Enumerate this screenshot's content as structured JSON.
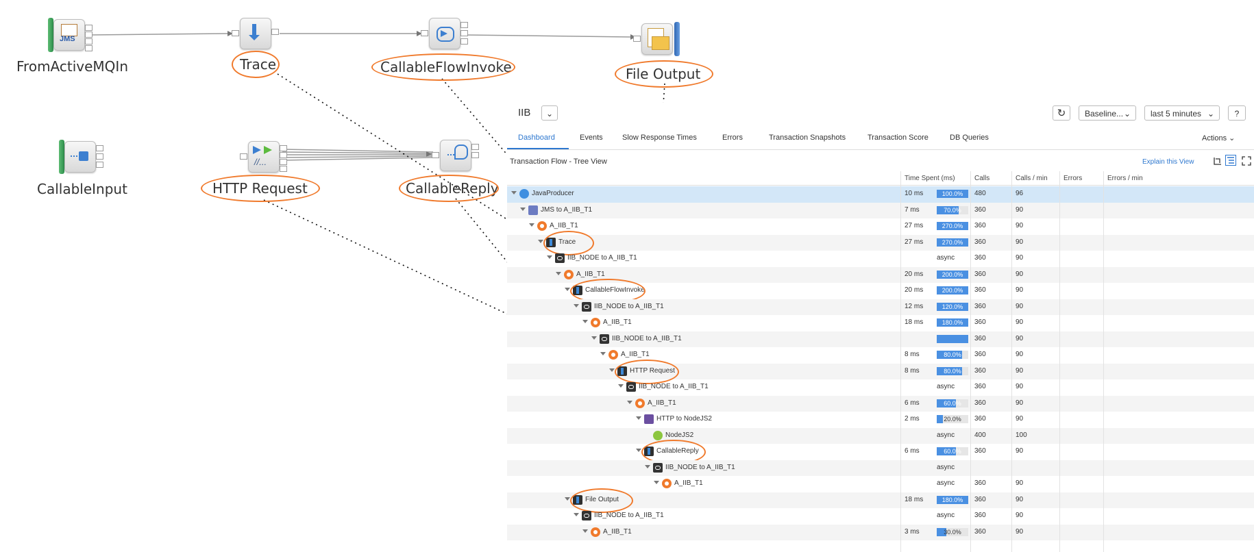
{
  "diagram": {
    "nodes": {
      "from_activemq": "FromActiveMQIn",
      "trace": "Trace",
      "callable_flow_invoke": "CallableFlowInvoke",
      "file_output": "File Output",
      "callable_input": "CallableInput",
      "http_request": "HTTP Request",
      "callable_reply": "CallableReply"
    },
    "icons": {
      "jms_text": "JMS",
      "http_text": "//..."
    },
    "highlight_color": "#f07a2c"
  },
  "dashboard": {
    "app_title": "IIB",
    "refresh_icon": "refresh-icon",
    "baseline_label": "Baseline...",
    "time_range_label": "last 5 minutes",
    "help_label": "?",
    "tabs": [
      "Dashboard",
      "Events",
      "Slow Response Times",
      "Errors",
      "Transaction Snapshots",
      "Transaction Score",
      "DB Queries"
    ],
    "actions_label": "Actions",
    "section_title": "Transaction Flow - Tree View",
    "explain_link": "Explain this View",
    "columns": {
      "time_spent": "Time Spent (ms)",
      "calls": "Calls",
      "calls_per_min": "Calls / min",
      "errors": "Errors",
      "errors_per_min": "Errors / min"
    },
    "accent_color": "#2d77cf",
    "rows": [
      {
        "name": "JavaProducer",
        "icon": "java",
        "level": 0,
        "time": "10 ms",
        "pct": "100.0%",
        "pct_value": 100,
        "calls": "480",
        "cpm": "96"
      },
      {
        "name": "JMS to A_IIB_T1",
        "icon": "jms",
        "level": 1,
        "time": "7 ms",
        "pct": "70.0%",
        "pct_value": 70,
        "calls": "360",
        "cpm": "90"
      },
      {
        "name": "A_IIB_T1",
        "icon": "gear",
        "level": 2,
        "time": "27 ms",
        "pct": "270.0%",
        "pct_value": 270,
        "calls": "360",
        "cpm": "90"
      },
      {
        "name": "Trace",
        "icon": "iib",
        "level": 3,
        "time": "27 ms",
        "pct": "270.0%",
        "pct_value": 270,
        "calls": "360",
        "cpm": "90"
      },
      {
        "name": "IIB_NODE to A_IIB_T1",
        "icon": "conn",
        "level": 4,
        "time": "",
        "async": "async",
        "calls": "360",
        "cpm": "90"
      },
      {
        "name": "A_IIB_T1",
        "icon": "gear",
        "level": 5,
        "time": "20 ms",
        "pct": "200.0%",
        "pct_value": 200,
        "calls": "360",
        "cpm": "90"
      },
      {
        "name": "CallableFlowInvoke",
        "icon": "iib",
        "level": 6,
        "time": "20 ms",
        "pct": "200.0%",
        "pct_value": 200,
        "calls": "360",
        "cpm": "90"
      },
      {
        "name": "IIB_NODE to A_IIB_T1",
        "icon": "conn",
        "level": 7,
        "time": "12 ms",
        "pct": "120.0%",
        "pct_value": 120,
        "calls": "360",
        "cpm": "90"
      },
      {
        "name": "A_IIB_T1",
        "icon": "gear",
        "level": 8,
        "time": "18 ms",
        "pct": "180.0%",
        "pct_value": 180,
        "calls": "360",
        "cpm": "90"
      },
      {
        "name": "IIB_NODE to A_IIB_T1",
        "icon": "conn",
        "level": 9,
        "time": "",
        "pct_value": 100,
        "calls": "360",
        "cpm": "90"
      },
      {
        "name": "A_IIB_T1",
        "icon": "gear",
        "level": 10,
        "time": "8 ms",
        "pct": "80.0%",
        "pct_value": 80,
        "calls": "360",
        "cpm": "90"
      },
      {
        "name": "HTTP Request",
        "icon": "iib",
        "level": 11,
        "time": "8 ms",
        "pct": "80.0%",
        "pct_value": 80,
        "calls": "360",
        "cpm": "90"
      },
      {
        "name": "IIB_NODE to A_IIB_T1",
        "icon": "conn",
        "level": 12,
        "time": "",
        "async": "async",
        "calls": "360",
        "cpm": "90"
      },
      {
        "name": "A_IIB_T1",
        "icon": "gear",
        "level": 13,
        "time": "6 ms",
        "pct": "60.0%",
        "pct_value": 60,
        "calls": "360",
        "cpm": "90"
      },
      {
        "name": "HTTP to NodeJS2",
        "icon": "http",
        "level": 14,
        "time": "2 ms",
        "pct": "20.0%",
        "pct_value": 20,
        "calls": "360",
        "cpm": "90"
      },
      {
        "name": "NodeJS2",
        "icon": "node",
        "level": 15,
        "time": "",
        "async": "async",
        "calls": "400",
        "cpm": "100"
      },
      {
        "name": "CallableReply",
        "icon": "iib",
        "level": 14,
        "time": "6 ms",
        "pct": "60.0%",
        "pct_value": 60,
        "calls": "360",
        "cpm": "90"
      },
      {
        "name": "IIB_NODE to A_IIB_T1",
        "icon": "conn",
        "level": 15,
        "time": "",
        "async": "async",
        "calls": "",
        "cpm": ""
      },
      {
        "name": "A_IIB_T1",
        "icon": "gear",
        "level": 16,
        "time": "",
        "async": "async",
        "calls": "360",
        "cpm": "90"
      },
      {
        "name": "File Output",
        "icon": "iib",
        "level": 6,
        "time": "18 ms",
        "pct": "180.0%",
        "pct_value": 180,
        "calls": "360",
        "cpm": "90"
      },
      {
        "name": "IIB_NODE to A_IIB_T1",
        "icon": "conn",
        "level": 7,
        "time": "",
        "async": "async",
        "calls": "360",
        "cpm": "90"
      },
      {
        "name": "A_IIB_T1",
        "icon": "gear",
        "level": 8,
        "time": "3 ms",
        "pct": "30.0%",
        "pct_value": 30,
        "calls": "360",
        "cpm": "90"
      }
    ]
  }
}
